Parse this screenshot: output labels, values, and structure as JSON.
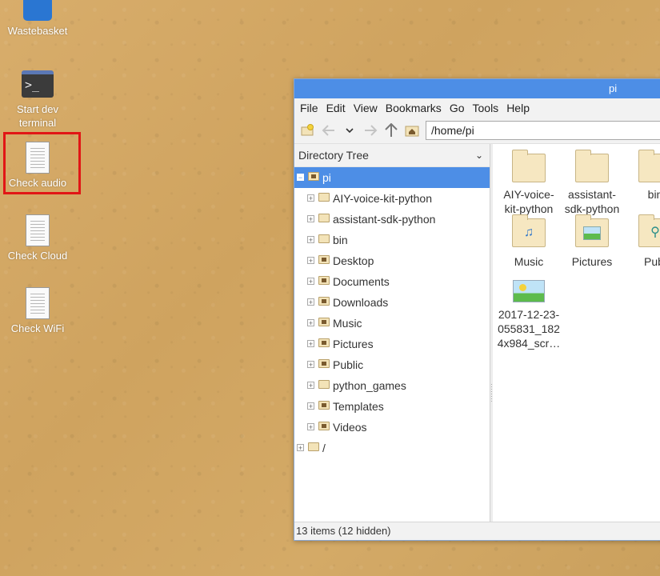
{
  "desktop": {
    "icons": [
      {
        "label": "Wastebasket",
        "icon": "wastebasket-icon"
      },
      {
        "label": "Start dev terminal",
        "icon": "terminal-icon"
      },
      {
        "label": "Check audio",
        "icon": "document-icon"
      },
      {
        "label": "Check Cloud",
        "icon": "document-icon"
      },
      {
        "label": "Check WiFi",
        "icon": "document-icon"
      }
    ],
    "selected_highlight_color": "#e11616"
  },
  "window": {
    "title": "pi",
    "menu": [
      "File",
      "Edit",
      "View",
      "Bookmarks",
      "Go",
      "Tools",
      "Help"
    ],
    "toolbar": {
      "new_tab_icon": "new-tab-icon",
      "back_icon": "arrow-left-icon",
      "history_icon": "chevron-down-icon",
      "forward_icon": "arrow-right-icon",
      "up_icon": "arrow-up-icon",
      "home_icon": "home-icon",
      "path": "/home/pi"
    },
    "side_pane": {
      "header": "Directory Tree",
      "root": "pi",
      "children": [
        "AIY-voice-kit-python",
        "assistant-sdk-python",
        "bin",
        "Desktop",
        "Documents",
        "Downloads",
        "Music",
        "Pictures",
        "Public",
        "python_games",
        "Templates",
        "Videos"
      ],
      "filesystem_root": "/"
    },
    "files": [
      {
        "name": "AIY-voice-kit-python",
        "line1": "AIY-voice-",
        "line2": "kit-python",
        "type": "folder"
      },
      {
        "name": "assistant-sdk-python",
        "line1": "assistant-",
        "line2": "sdk-python",
        "type": "folder"
      },
      {
        "name": "bin",
        "line1": "bin",
        "type": "folder"
      },
      {
        "name": "Music",
        "line1": "Music",
        "type": "music-folder"
      },
      {
        "name": "Pictures",
        "line1": "Pictures",
        "type": "pictures-folder"
      },
      {
        "name": "Public",
        "line1": "Publ",
        "type": "public-folder"
      },
      {
        "name": "screenshot",
        "line1": "2017-12-23-",
        "line2": "055831_182",
        "line3": "4x984_scr…",
        "type": "image"
      }
    ],
    "status": "13 items (12 hidden)",
    "accent_color": "#4d8ee6"
  }
}
